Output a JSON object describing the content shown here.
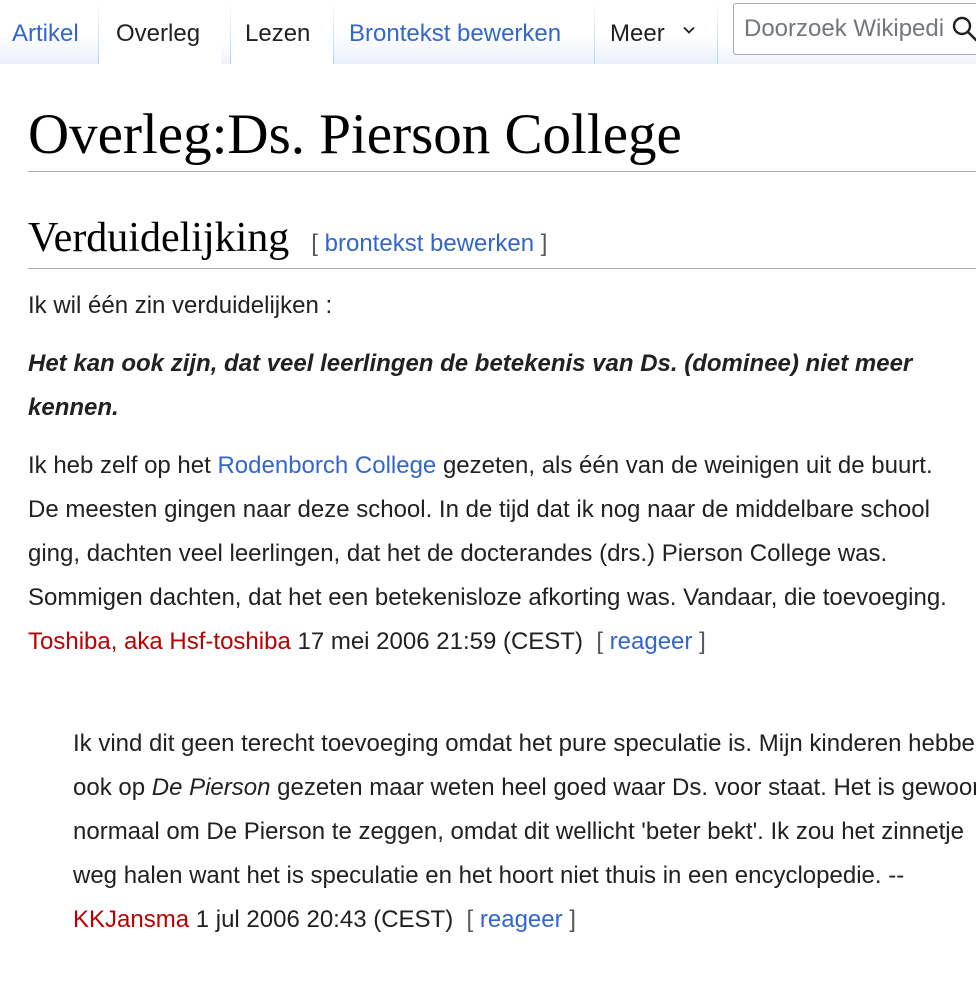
{
  "tabs": {
    "artikel": "Artikel",
    "overleg": "Overleg",
    "lezen": "Lezen",
    "bewerken": "Brontekst bewerken",
    "meer": "Meer"
  },
  "search": {
    "placeholder": "Doorzoek Wikipedia"
  },
  "page": {
    "title": "Overleg:Ds. Pierson College"
  },
  "section": {
    "heading": "Verduidelijking",
    "edit_open": "[",
    "edit_label": "brontekst bewerken",
    "edit_close": "]"
  },
  "post1": {
    "intro": "Ik wil één zin verduidelijken :",
    "quote": "Het kan ook zijn, dat veel leerlingen de betekenis van Ds. (dominee) niet meer kennen.",
    "text_a": "Ik heb zelf op het ",
    "link_school": "Rodenborch College",
    "text_b": " gezeten, als één van de weinigen uit de buurt. De meesten gingen naar deze school. In de tijd dat ik nog naar de middelbare school ging, dachten veel leerlingen, dat het de docterandes (drs.) Pierson College was. Sommigen dachten, dat het een betekenisloze afkorting was. Vandaar, die toevoeging. ",
    "user": "Toshiba, aka Hsf-toshiba",
    "timestamp": " 17 mei 2006 21:59 (CEST)",
    "reply_label": "reageer"
  },
  "post2": {
    "text_a": "Ik vind dit geen terecht toevoeging omdat het pure speculatie is. Mijn kinderen hebben ook op ",
    "italic": "De Pierson",
    "text_b": " gezeten maar weten heel goed waar Ds. voor staat. Het is gewoon normaal om De Pierson te zeggen, omdat dit wellicht 'beter bekt'. Ik zou het zinnetje weg halen want het is speculatie en het hoort niet thuis in een encyclopedie. --",
    "user": "KKJansma",
    "timestamp": " 1 jul 2006 20:43 (CEST)",
    "reply_label": "reageer"
  },
  "colors": {
    "link": "#3366cc",
    "redlink": "#ba0000",
    "text": "#202122"
  }
}
